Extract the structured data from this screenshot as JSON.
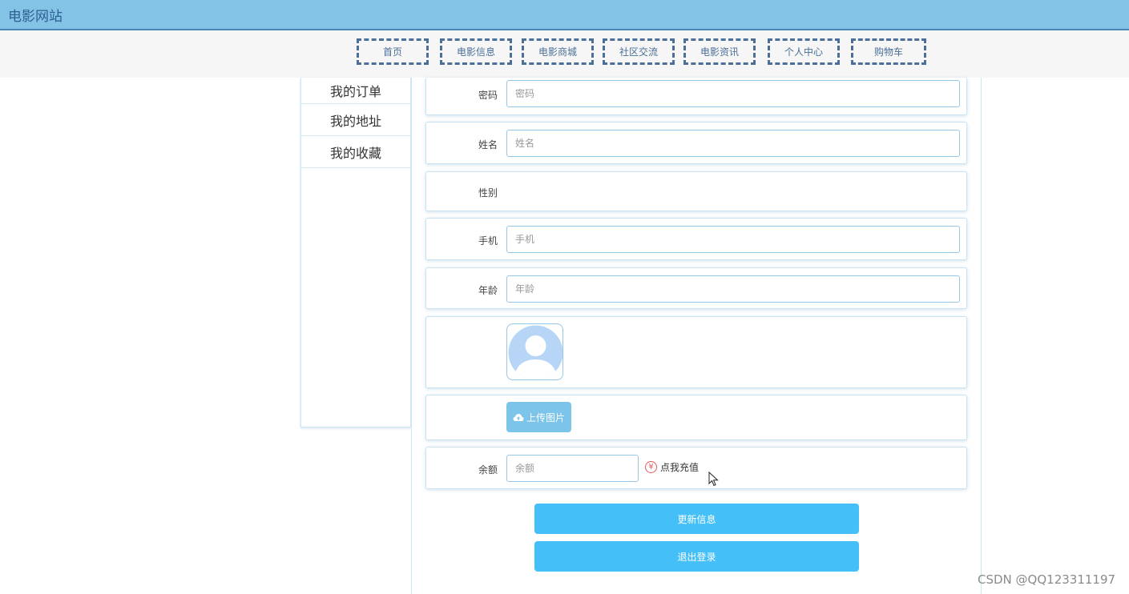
{
  "site": {
    "title": "电影网站"
  },
  "nav": {
    "items": [
      {
        "label": "首页"
      },
      {
        "label": "电影信息"
      },
      {
        "label": "电影商城"
      },
      {
        "label": "社区交流"
      },
      {
        "label": "电影资讯"
      },
      {
        "label": "个人中心"
      },
      {
        "label": "购物车"
      }
    ]
  },
  "sidebar": {
    "items": [
      {
        "label": "我的订单"
      },
      {
        "label": "我的地址"
      },
      {
        "label": "我的收藏"
      }
    ]
  },
  "form": {
    "password": {
      "label": "密码",
      "placeholder": "密码"
    },
    "name": {
      "label": "姓名",
      "placeholder": "姓名"
    },
    "gender": {
      "label": "性别"
    },
    "phone": {
      "label": "手机",
      "placeholder": "手机"
    },
    "age": {
      "label": "年龄",
      "placeholder": "年龄"
    },
    "upload_label": "上传图片",
    "balance": {
      "label": "余额",
      "placeholder": "余额"
    },
    "recharge_symbol": "¥",
    "recharge_label": "点我充值"
  },
  "actions": {
    "update_label": "更新信息",
    "logout_label": "退出登录"
  },
  "watermark": "CSDN @QQ123311197",
  "colors": {
    "topbar": "#82c3e6",
    "nav_border": "#4c6f99",
    "button": "#45bff7",
    "upload_button": "#7cc4ea"
  },
  "icons": {
    "upload": "cloud-upload-icon",
    "avatar": "user-placeholder-icon",
    "recharge": "yen-icon"
  }
}
